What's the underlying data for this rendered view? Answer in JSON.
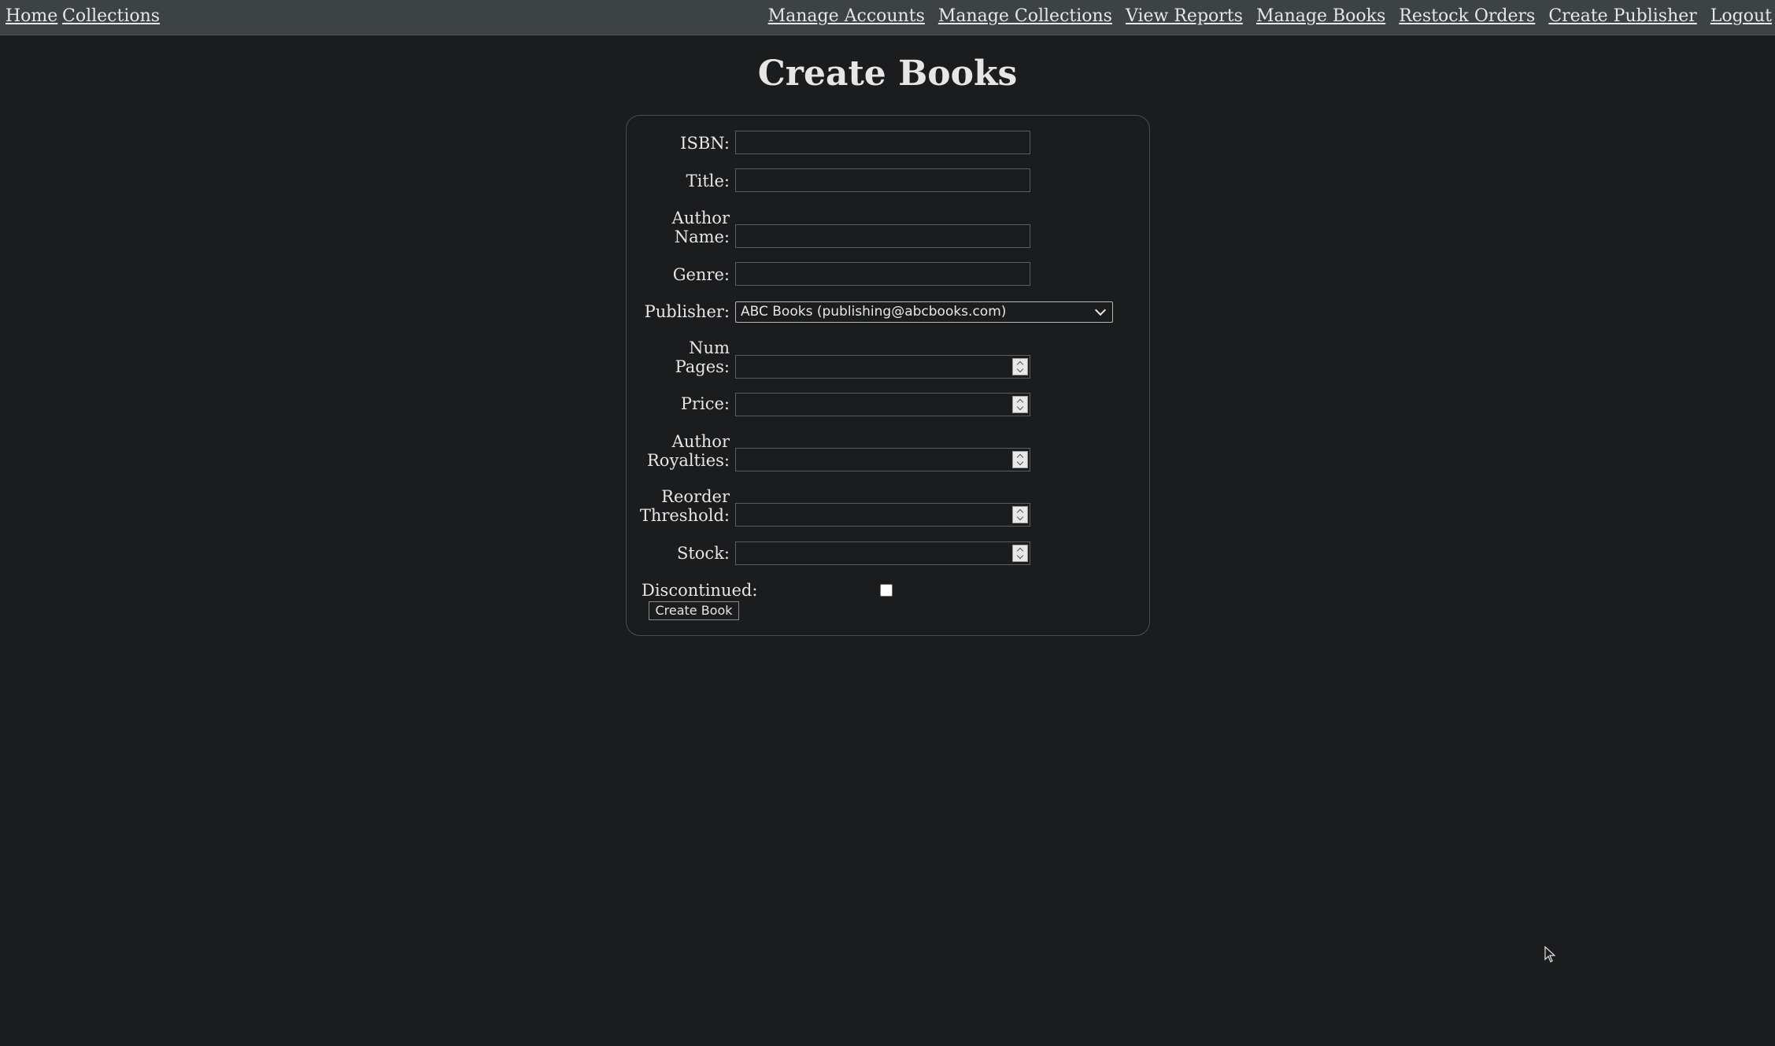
{
  "nav": {
    "left": [
      "Home",
      "Collections"
    ],
    "right": [
      "Manage Accounts",
      "Manage Collections",
      "View Reports",
      "Manage Books",
      "Restock Orders",
      "Create Publisher",
      "Logout"
    ]
  },
  "page": {
    "title": "Create Books"
  },
  "form": {
    "isbn_label": "ISBN:",
    "title_label": "Title:",
    "author_label_1": "Author",
    "author_label_2": "Name:",
    "genre_label": "Genre:",
    "publisher_label": "Publisher:",
    "publisher_selected": "ABC Books (publishing@abcbooks.com)",
    "num_pages_label_1": "Num",
    "num_pages_label_2": "Pages:",
    "price_label": "Price:",
    "royalties_label_1": "Author",
    "royalties_label_2": "Royalties:",
    "reorder_label_1": "Reorder",
    "reorder_label_2": "Threshold:",
    "stock_label": "Stock:",
    "discontinued_label": "Discontinued:",
    "discontinued_checked": false,
    "submit_label": "Create Book"
  },
  "icons": {
    "publisher_dropdown": "chevron-down-icon",
    "number_spinner": "spinner-arrows-icon",
    "cursor": "mouse-pointer-icon"
  }
}
